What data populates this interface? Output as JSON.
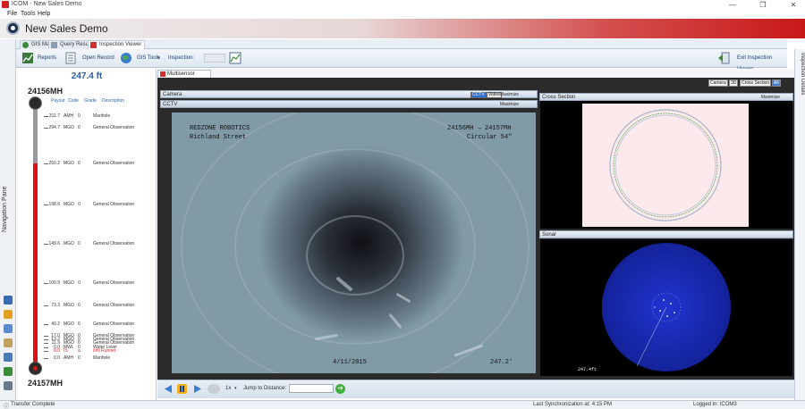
{
  "window": {
    "title": "ICOM - New Sales Demo",
    "minimize_glyph": "—",
    "restore_glyph": "❐",
    "close_glyph": "✕"
  },
  "menu": [
    "File",
    "Tools",
    "Help"
  ],
  "banner": {
    "title": "New Sales Demo"
  },
  "tabs": [
    {
      "label": "GIS Map",
      "icon": "globe-icon"
    },
    {
      "label": "Query Results",
      "icon": "table-icon"
    },
    {
      "label": "Inspection Viewer",
      "icon": "inspection-icon",
      "active": true
    }
  ],
  "ribbon": {
    "reports": "Reports",
    "open_record": "Open Record",
    "gis_tools": "GIS Tools",
    "inspection_label": "Inspection:",
    "exit_viewer": "Exit Inspection Viewer"
  },
  "side_panels": {
    "navigation": "Navigation Pane",
    "inspection_details": "Inspection Details"
  },
  "inspection": {
    "distance": "247.4 ft",
    "start_node": "24156MH",
    "end_node": "24157MH",
    "columns": [
      "Payout",
      "Code",
      "Grade",
      "Description"
    ],
    "observations": [
      {
        "payout": "311.7",
        "code": "AMH",
        "grade": "0",
        "desc": "Manhole"
      },
      {
        "payout": "294.7",
        "code": "MGO",
        "grade": "0",
        "desc": "General Observation"
      },
      {
        "payout": "250.2",
        "code": "MGO",
        "grade": "0",
        "desc": "General Observation"
      },
      {
        "payout": "198.6",
        "code": "MGO",
        "grade": "0",
        "desc": "General Observation"
      },
      {
        "payout": "149.6",
        "code": "MGO",
        "grade": "0",
        "desc": "General Observation"
      },
      {
        "payout": "100.9",
        "code": "MGO",
        "grade": "0",
        "desc": "General Observation"
      },
      {
        "payout": "73.3",
        "code": "MGO",
        "grade": "0",
        "desc": "General Observation"
      },
      {
        "payout": "49.2",
        "code": "MGO",
        "grade": "0",
        "desc": "General Observation"
      },
      {
        "payout": "17.0",
        "code": "MGO",
        "grade": "0",
        "desc": "General Observation"
      },
      {
        "payout": "13.2",
        "code": "MGO",
        "grade": "0",
        "desc": "General Observation"
      },
      {
        "payout": "11.9",
        "code": "MGO",
        "grade": "0",
        "desc": "General Observation"
      },
      {
        "payout": "0.0",
        "code": "MWL",
        "grade": "0",
        "desc": "Water Level"
      },
      {
        "payout": "0.0",
        "code": "IS",
        "grade": "a",
        "desc": "Infil Runner",
        "alert": true
      },
      {
        "payout": "0.0",
        "code": "AMH",
        "grade": "0",
        "desc": "Manhole"
      }
    ]
  },
  "multisensor": {
    "tab": "Multisensor",
    "view_buttons": [
      "Camera",
      "3D",
      "Cross Section",
      "All"
    ],
    "active_view": "All",
    "camera_panel": "Camera",
    "cctv_panel": "CCTV",
    "cctv_buttons": [
      "CCTV",
      "Video"
    ],
    "maximize": "Maximize",
    "cross_section_panel": "Cross Section",
    "sonar_panel": "Sonar",
    "video_overlay": {
      "company": "REDZONE ROBOTICS",
      "street": "Richland Street",
      "segment": "24156MH → 24157MH",
      "pipe": "Circular 54\"",
      "date": "4/11/2015",
      "distance": "247.2'",
      "sonar_readout": "247.4ft"
    }
  },
  "transport": {
    "speed": "1x",
    "jump_label": "Jump to Distance:",
    "go_glyph": "➜"
  },
  "status": {
    "left": "Transfer Complete",
    "sync": "Last Synchronization at: 4:15 PM",
    "user": "Logged in: ICOM3"
  },
  "colors": {
    "accent_blue": "#2b5fa5",
    "banner_red": "#c81818",
    "track_red": "#e01010",
    "sonar_blue": "#1a2cb8"
  }
}
